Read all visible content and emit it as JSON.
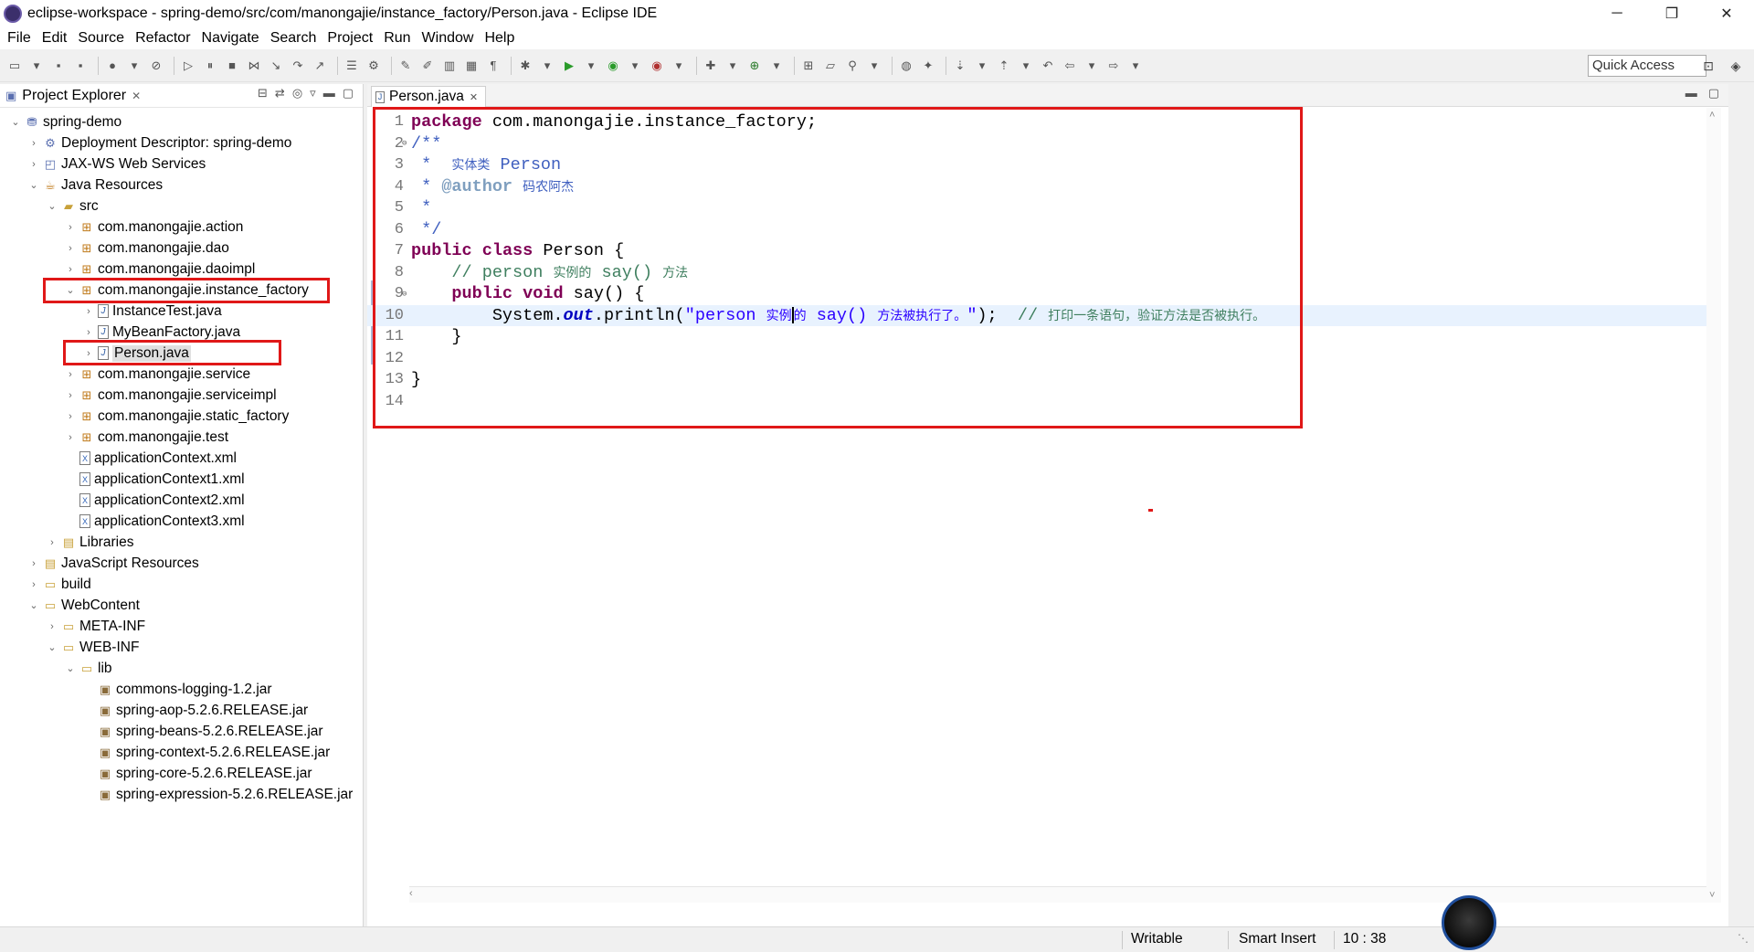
{
  "window": {
    "title": "eclipse-workspace - spring-demo/src/com/manongajie/instance_factory/Person.java - Eclipse IDE",
    "minimize": "─",
    "maximize": "❐",
    "close": "✕"
  },
  "menu": [
    "File",
    "Edit",
    "Source",
    "Refactor",
    "Navigate",
    "Search",
    "Project",
    "Run",
    "Window",
    "Help"
  ],
  "toolbar": {
    "quick_access": "Quick Access",
    "icons": [
      "new-icon",
      "save-icon",
      "save-all-icon",
      "print-icon",
      "debug-icon",
      "run-icon",
      "search-icon",
      "back-icon",
      "forward-icon",
      "perspective-icon"
    ]
  },
  "explorer": {
    "title": "Project Explorer",
    "close": "✕",
    "items": [
      {
        "label": "spring-demo",
        "icon": "project-icon",
        "twisty": "⌄"
      },
      {
        "label": "Deployment Descriptor: spring-demo",
        "icon": "deployment-descriptor-icon",
        "twisty": "›"
      },
      {
        "label": "JAX-WS Web Services",
        "icon": "web-services-icon",
        "twisty": "›"
      },
      {
        "label": "Java Resources",
        "icon": "java-resources-icon",
        "twisty": "⌄"
      },
      {
        "label": "src",
        "icon": "source-folder-icon",
        "twisty": "⌄"
      },
      {
        "label": "com.manongajie.action",
        "icon": "package-icon",
        "twisty": "›"
      },
      {
        "label": "com.manongajie.dao",
        "icon": "package-icon",
        "twisty": "›"
      },
      {
        "label": "com.manongajie.daoimpl",
        "icon": "package-icon",
        "twisty": "›"
      },
      {
        "label": "com.manongajie.instance_factory",
        "icon": "package-icon",
        "twisty": "⌄"
      },
      {
        "label": "InstanceTest.java",
        "icon": "java-file-icon",
        "twisty": "›"
      },
      {
        "label": "MyBeanFactory.java",
        "icon": "java-file-icon",
        "twisty": "›"
      },
      {
        "label": "Person.java",
        "icon": "java-file-icon",
        "twisty": "›"
      },
      {
        "label": "com.manongajie.service",
        "icon": "package-icon",
        "twisty": "›"
      },
      {
        "label": "com.manongajie.serviceimpl",
        "icon": "package-icon",
        "twisty": "›"
      },
      {
        "label": "com.manongajie.static_factory",
        "icon": "package-icon",
        "twisty": "›"
      },
      {
        "label": "com.manongajie.test",
        "icon": "package-icon",
        "twisty": "›"
      },
      {
        "label": "applicationContext.xml",
        "icon": "xml-file-icon",
        "twisty": ""
      },
      {
        "label": "applicationContext1.xml",
        "icon": "xml-file-icon",
        "twisty": ""
      },
      {
        "label": "applicationContext2.xml",
        "icon": "xml-file-icon",
        "twisty": ""
      },
      {
        "label": "applicationContext3.xml",
        "icon": "xml-file-icon",
        "twisty": ""
      },
      {
        "label": "Libraries",
        "icon": "libraries-icon",
        "twisty": "›"
      },
      {
        "label": "JavaScript Resources",
        "icon": "javascript-resources-icon",
        "twisty": "›"
      },
      {
        "label": "build",
        "icon": "folder-icon",
        "twisty": "›"
      },
      {
        "label": "WebContent",
        "icon": "folder-icon",
        "twisty": "⌄"
      },
      {
        "label": "META-INF",
        "icon": "folder-icon",
        "twisty": "›"
      },
      {
        "label": "WEB-INF",
        "icon": "folder-icon",
        "twisty": "⌄"
      },
      {
        "label": "lib",
        "icon": "folder-icon",
        "twisty": "⌄"
      },
      {
        "label": "commons-logging-1.2.jar",
        "icon": "jar-icon",
        "twisty": ""
      },
      {
        "label": "spring-aop-5.2.6.RELEASE.jar",
        "icon": "jar-icon",
        "twisty": ""
      },
      {
        "label": "spring-beans-5.2.6.RELEASE.jar",
        "icon": "jar-icon",
        "twisty": ""
      },
      {
        "label": "spring-context-5.2.6.RELEASE.jar",
        "icon": "jar-icon",
        "twisty": ""
      },
      {
        "label": "spring-core-5.2.6.RELEASE.jar",
        "icon": "jar-icon",
        "twisty": ""
      },
      {
        "label": "spring-expression-5.2.6.RELEASE.jar",
        "icon": "jar-icon",
        "twisty": ""
      }
    ]
  },
  "editor": {
    "tab_label": "Person.java",
    "tab_close": "✕",
    "lines": [
      {
        "n": "1",
        "fold": "",
        "tokens": [
          {
            "t": "package",
            "c": "kw"
          },
          {
            "t": " com.manongajie.instance_factory;",
            "c": ""
          }
        ]
      },
      {
        "n": "2",
        "fold": "⊖",
        "tokens": [
          {
            "t": "/**",
            "c": "jdoc"
          }
        ]
      },
      {
        "n": "3",
        "fold": "",
        "tokens": [
          {
            "t": " *  ",
            "c": "jdoc"
          },
          {
            "t": "实体类",
            "c": "jdoc cjk"
          },
          {
            "t": " Person",
            "c": "jdoc"
          }
        ]
      },
      {
        "n": "4",
        "fold": "",
        "tokens": [
          {
            "t": " * ",
            "c": "jdoc"
          },
          {
            "t": "@author",
            "c": "jdoc-tag"
          },
          {
            "t": " ",
            "c": "jdoc"
          },
          {
            "t": "码农阿杰",
            "c": "jdoc cjk"
          }
        ]
      },
      {
        "n": "5",
        "fold": "",
        "tokens": [
          {
            "t": " *",
            "c": "jdoc"
          }
        ]
      },
      {
        "n": "6",
        "fold": "",
        "tokens": [
          {
            "t": " */",
            "c": "jdoc"
          }
        ]
      },
      {
        "n": "7",
        "fold": "",
        "tokens": [
          {
            "t": "public",
            "c": "kw"
          },
          {
            "t": " ",
            "c": ""
          },
          {
            "t": "class",
            "c": "kw"
          },
          {
            "t": " Person {",
            "c": ""
          }
        ]
      },
      {
        "n": "8",
        "fold": "",
        "tokens": [
          {
            "t": "    // person ",
            "c": "cmt"
          },
          {
            "t": "实例的",
            "c": "cmt cjk"
          },
          {
            "t": " say() ",
            "c": "cmt"
          },
          {
            "t": "方法",
            "c": "cmt cjk"
          }
        ]
      },
      {
        "n": "9",
        "fold": "⊖",
        "tokens": [
          {
            "t": "    ",
            "c": ""
          },
          {
            "t": "public",
            "c": "kw"
          },
          {
            "t": " ",
            "c": ""
          },
          {
            "t": "void",
            "c": "kw"
          },
          {
            "t": " say() {",
            "c": ""
          }
        ]
      },
      {
        "n": "10",
        "fold": "",
        "current": true,
        "tokens": [
          {
            "t": "        System.",
            "c": ""
          },
          {
            "t": "out",
            "c": "fld"
          },
          {
            "t": ".println(",
            "c": ""
          },
          {
            "t": "\"person ",
            "c": "str"
          },
          {
            "t": "实例",
            "c": "str cjk"
          },
          {
            "t": "CURSOR",
            "c": "cursor"
          },
          {
            "t": "的",
            "c": "str cjk"
          },
          {
            "t": " say() ",
            "c": "str"
          },
          {
            "t": "方法被执行了。",
            "c": "str cjk"
          },
          {
            "t": "\"",
            "c": "str"
          },
          {
            "t": ");  ",
            "c": ""
          },
          {
            "t": "// ",
            "c": "cmt"
          },
          {
            "t": "打印一条语句，验证方法是否被执行。",
            "c": "cmt cjk"
          }
        ]
      },
      {
        "n": "11",
        "fold": "",
        "tokens": [
          {
            "t": "    }",
            "c": ""
          }
        ]
      },
      {
        "n": "12",
        "fold": "",
        "tokens": []
      },
      {
        "n": "13",
        "fold": "",
        "tokens": [
          {
            "t": "}",
            "c": ""
          }
        ]
      },
      {
        "n": "14",
        "fold": "",
        "tokens": []
      }
    ]
  },
  "status": {
    "writable": "Writable",
    "insert_mode": "Smart Insert",
    "position": "10 : 38"
  },
  "colors": {
    "annotation_red": "#e01818",
    "keyword": "#7f0055",
    "javadoc": "#3f5fbf",
    "comment": "#3f7f5f",
    "string": "#2a00ff",
    "current_line": "#e8f2fe"
  }
}
